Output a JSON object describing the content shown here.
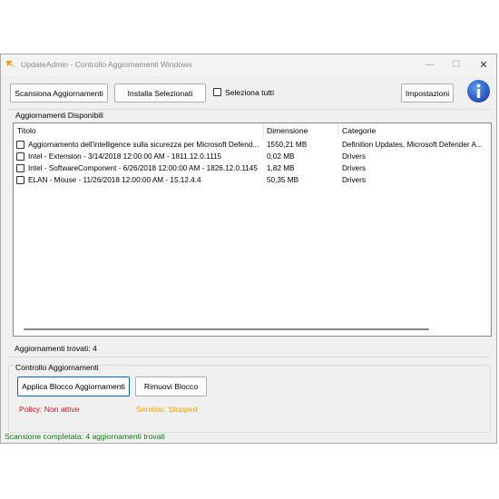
{
  "window": {
    "title": "UpdateAdmin - Controllo Aggiornamenti Windows",
    "minimize_glyph": "—",
    "maximize_glyph": "☐",
    "close_glyph": "✕"
  },
  "toolbar": {
    "scan_label": "Scansiona Aggiornamenti",
    "install_label": "Installa Selezionati",
    "select_all_label": "Seleziona tutti",
    "settings_label": "Impostazioni",
    "info_icon": "info-icon"
  },
  "updates": {
    "section_label": "Aggiornamenti Disponibili",
    "columns": [
      "Titolo",
      "Dimensione",
      "Categorie"
    ],
    "rows": [
      {
        "title": "Aggiornamento dell'intelligence sulla sicurezza per Microsoft Defend...",
        "size": "1550,21 MB",
        "category": "Definition Updates, Microsoft Defender A...",
        "checked": false
      },
      {
        "title": "Intel - Extension - 3/14/2018 12:00:00 AM - 1811.12.0.1115",
        "size": "0,02 MB",
        "category": "Drivers",
        "checked": false
      },
      {
        "title": "Intel - SoftwareComponent - 6/26/2018 12:00:00 AM - 1826.12.0.1145",
        "size": "1,82 MB",
        "category": "Drivers",
        "checked": false
      },
      {
        "title": "ELAN - Mouse - 11/26/2018 12:00:00 AM - 15.12.4.4",
        "size": "50,35 MB",
        "category": "Drivers",
        "checked": false
      }
    ],
    "count_label": "Aggiornamenti trovati: 4"
  },
  "control": {
    "group_label": "Controllo Aggiornamenti",
    "apply_label": "Applica Blocco Aggiornamenti",
    "remove_label": "Rimuovi Blocco",
    "policy_status": "Policy: Non attive",
    "service_status": "Servizio: Stopped"
  },
  "status_bar": {
    "text": "Scansione completata: 4 aggiornamenti trovati"
  },
  "colors": {
    "policy_status": "#e81123",
    "service_status": "#f7a300",
    "status_bar": "#107c10",
    "info_icon": "#1e5bc6"
  }
}
